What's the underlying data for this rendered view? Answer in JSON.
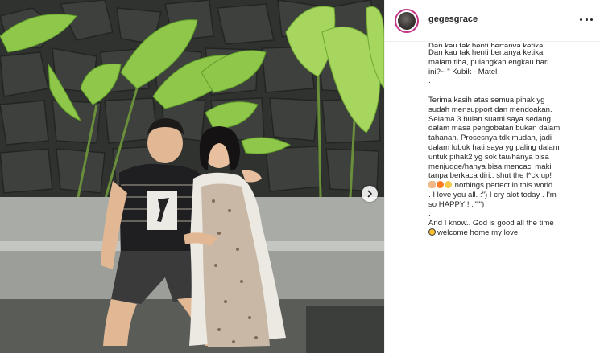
{
  "profile": {
    "username": "gegesgrace",
    "avatar_icon": "profile-photo",
    "story_ring_color": "#c13584"
  },
  "carousel": {
    "next_icon": "chevron-right-icon"
  },
  "menu": {
    "icon": "more-options-icon"
  },
  "caption": {
    "lines": [
      "Dan kau tak henti bertanya ketika",
      "malam tiba, pulangkah engkau hari",
      "ini?~ \" Kubik - Matel",
      ".",
      ".",
      "Terima kasih atas semua pihak yg",
      "sudah mensupport dan mendoakan.",
      "Selama 3 bulan suami saya sedang",
      "dalam masa pengobatan bukan dalam",
      "tahanan. Prosesnya tdk mudah, jadi",
      "dalam lubuk hati saya yg paling dalam",
      "untuk pihak2 yg sok tau/hanya bisa",
      "menjudge/hanya bisa mencaci maki",
      "tanpa berkaca diri.. shut the f*ck up!"
    ],
    "emoji_line": "nothings perfect in this world",
    "lines_after": [
      ". I love you all. :\") I cry alot today . I'm",
      "so HAPPY ! :\"\"\")",
      ".",
      "And I know.. God is good all the time"
    ],
    "last_line": "welcome home my love"
  },
  "colors": {
    "text": "#262626",
    "border": "#efefef"
  }
}
